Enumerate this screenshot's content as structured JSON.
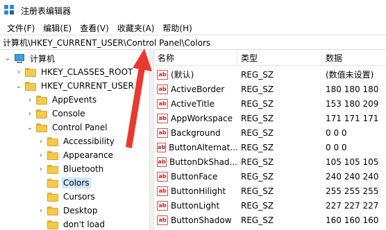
{
  "window": {
    "title": "注册表编辑器",
    "icon": "regedit-icon"
  },
  "menubar": {
    "items": [
      "文件(F)",
      "编辑(E)",
      "查看(V)",
      "收藏夹(A)",
      "帮助(H)"
    ]
  },
  "address": {
    "path": "计算机\\HKEY_CURRENT_USER\\Control Panel\\Colors"
  },
  "tree": {
    "items": [
      {
        "label": "计算机",
        "icon": "computer-icon",
        "chevron": "expanded"
      },
      {
        "label": "HKEY_CLASSES_ROOT",
        "icon": "folder-icon",
        "chevron": "collapsed"
      },
      {
        "label": "HKEY_CURRENT_USER",
        "icon": "folder-icon",
        "chevron": "expanded"
      },
      {
        "label": "AppEvents",
        "icon": "folder-icon",
        "chevron": "collapsed"
      },
      {
        "label": "Console",
        "icon": "folder-icon",
        "chevron": "collapsed"
      },
      {
        "label": "Control Panel",
        "icon": "folder-icon",
        "chevron": "expanded"
      },
      {
        "label": "Accessibility",
        "icon": "folder-icon",
        "chevron": "collapsed"
      },
      {
        "label": "Appearance",
        "icon": "folder-icon",
        "chevron": "collapsed"
      },
      {
        "label": "Bluetooth",
        "icon": "folder-icon",
        "chevron": "collapsed"
      },
      {
        "label": "Colors",
        "icon": "folder-icon",
        "chevron": "none",
        "selected": true
      },
      {
        "label": "Cursors",
        "icon": "folder-icon",
        "chevron": "none"
      },
      {
        "label": "Desktop",
        "icon": "folder-icon",
        "chevron": "collapsed"
      },
      {
        "label": "don't load",
        "icon": "folder-icon",
        "chevron": "none"
      }
    ]
  },
  "values": {
    "headers": {
      "name": "名称",
      "type": "类型",
      "data": "数据"
    },
    "rows": [
      {
        "name": "(默认)",
        "type": "REG_SZ",
        "data": "(数值未设置)"
      },
      {
        "name": "ActiveBorder",
        "type": "REG_SZ",
        "data": "180 180 180"
      },
      {
        "name": "ActiveTitle",
        "type": "REG_SZ",
        "data": "153 180 209"
      },
      {
        "name": "AppWorkspace",
        "type": "REG_SZ",
        "data": "171 171 171"
      },
      {
        "name": "Background",
        "type": "REG_SZ",
        "data": "0 0 0"
      },
      {
        "name": "ButtonAlternat...",
        "type": "REG_SZ",
        "data": "0 0 0"
      },
      {
        "name": "ButtonDkShad...",
        "type": "REG_SZ",
        "data": "105 105 105"
      },
      {
        "name": "ButtonFace",
        "type": "REG_SZ",
        "data": "240 240 240"
      },
      {
        "name": "ButtonHilight",
        "type": "REG_SZ",
        "data": "255 255 255"
      },
      {
        "name": "ButtonLight",
        "type": "REG_SZ",
        "data": "227 227 227"
      },
      {
        "name": "ButtonShadow",
        "type": "REG_SZ",
        "data": "160 160 160"
      }
    ],
    "value_icon": "ab-string-icon",
    "value_icon_text": "ab"
  },
  "colors": {
    "selection": "#cce8ff",
    "annotation_arrow": "#e8392f",
    "folder": "#f5c94b"
  }
}
